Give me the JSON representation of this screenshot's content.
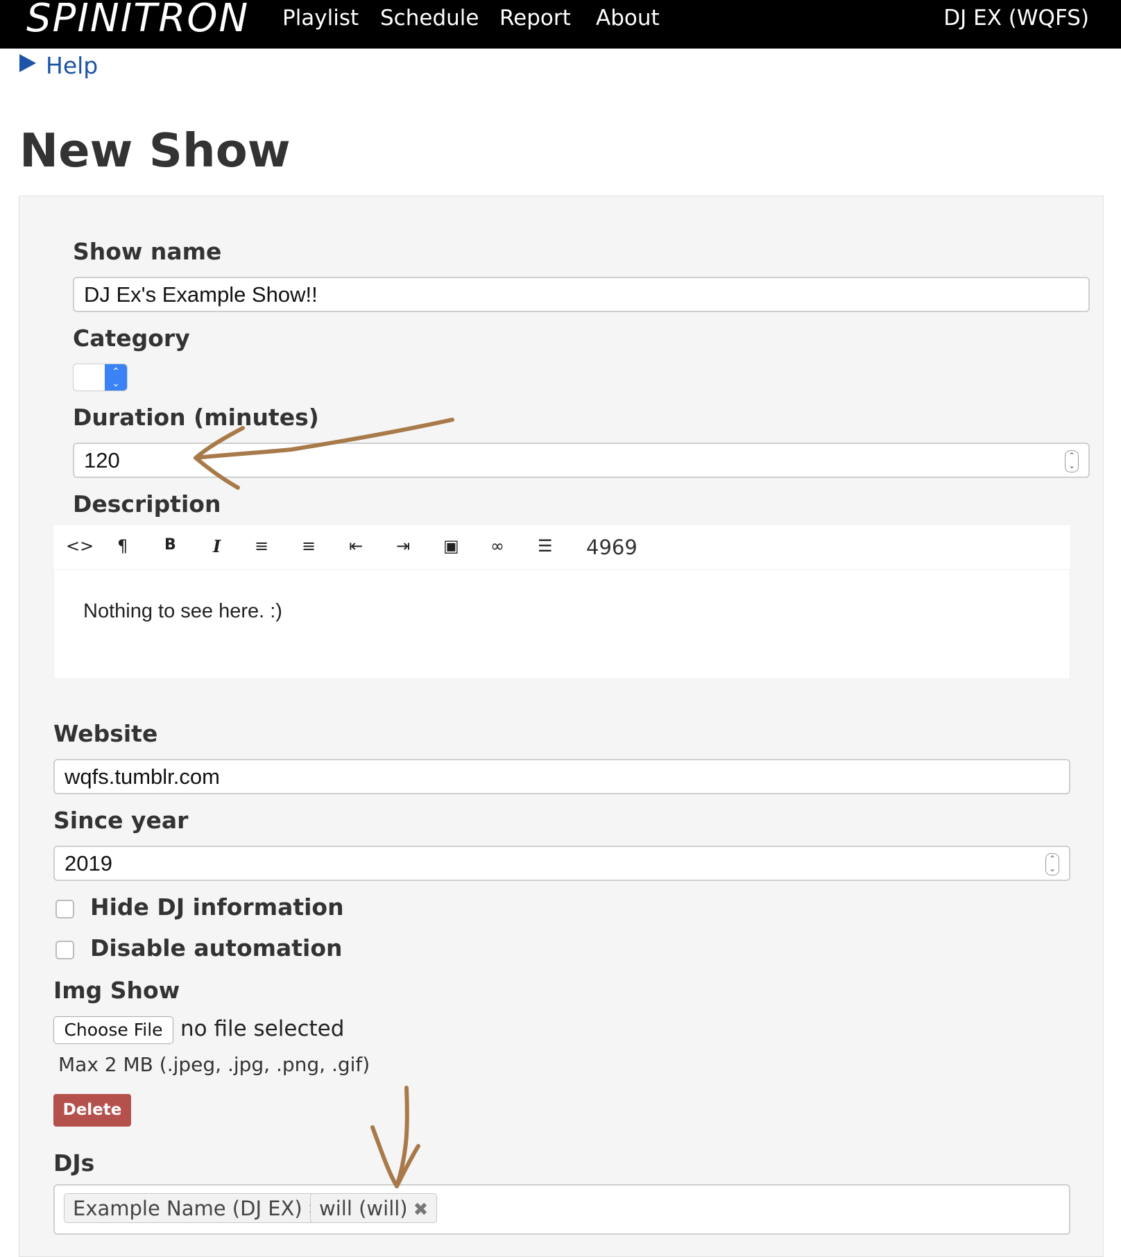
{
  "nav": {
    "brand": "SPINITRON",
    "items": [
      "Playlist",
      "Schedule",
      "Report",
      "About"
    ],
    "user": "DJ EX (WQFS)"
  },
  "help": "Help",
  "page_title": "New Show",
  "form": {
    "show_name": {
      "label": "Show name",
      "value": "DJ Ex's Example Show!!"
    },
    "category": {
      "label": "Category",
      "value": ""
    },
    "duration": {
      "label": "Duration (minutes)",
      "value": "120"
    },
    "description": {
      "label": "Description",
      "toolbar_icons": [
        "code-view-icon",
        "paragraph-icon",
        "bold-icon",
        "italic-icon",
        "bullet-list-icon",
        "numbered-list-icon",
        "outdent-icon",
        "indent-icon",
        "image-icon",
        "link-icon",
        "align-icon"
      ],
      "char_counter": "4969",
      "text": "Nothing to see here. :)"
    },
    "website": {
      "label": "Website",
      "value": "wqfs.tumblr.com"
    },
    "since_year": {
      "label": "Since year",
      "value": "2019"
    },
    "hide_dj": {
      "label": "Hide DJ information",
      "checked": false
    },
    "disable_automation": {
      "label": "Disable automation",
      "checked": false
    },
    "img_show": {
      "label": "Img Show",
      "choose_file": "Choose File",
      "status": "no file selected",
      "hint": "Max 2 MB (.jpeg, .jpg, .png, .gif)",
      "delete": "Delete"
    },
    "djs": {
      "label": "DJs",
      "tags": [
        "Example Name (DJ EX)",
        "will (will)"
      ]
    }
  },
  "colors": {
    "nav_bg": "#000000",
    "link": "#1c54a6",
    "delete_bg": "#b5514d",
    "annotation": "#a87a4a"
  }
}
